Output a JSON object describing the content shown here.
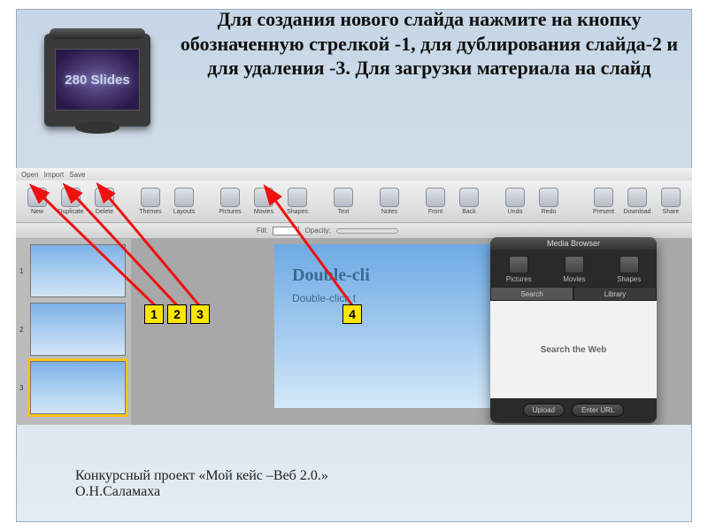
{
  "logo_text": "280 Slides",
  "headline": "Для создания нового слайда нажмите на кнопку обозначенную стрелкой -1, для дублирования слайда-2 и для удаления -3. Для загрузки материала на слайд",
  "browser_tabs": {
    "open": "Open",
    "import": "Import",
    "save": "Save"
  },
  "toolbar": {
    "new": "New",
    "duplicate": "Duplicate",
    "delete": "Delete",
    "themes": "Themes",
    "layouts": "Layouts",
    "pictures": "Pictures",
    "movies": "Movies",
    "shapes": "Shapes",
    "text": "Text",
    "notes": "Notes",
    "front": "Front",
    "back": "Back",
    "undo": "Undo",
    "redo": "Redo",
    "present": "Present",
    "download": "Download",
    "share": "Share"
  },
  "ruler": {
    "fill": "Fill:",
    "opacity": "Opacity:"
  },
  "thumbs": [
    {
      "num": "1"
    },
    {
      "num": "2"
    },
    {
      "num": "3"
    }
  ],
  "slide": {
    "title": "Double-cli",
    "subtitle": "Double-click t"
  },
  "media_browser": {
    "title": "Media Browser",
    "tabs": {
      "pictures": "Pictures",
      "movies": "Movies",
      "shapes": "Shapes"
    },
    "subtabs": {
      "search": "Search",
      "library": "Library"
    },
    "body": "Search the Web",
    "upload": "Upload",
    "enter_url": "Enter URL"
  },
  "markers": {
    "m1": "1",
    "m2": "2",
    "m3": "3",
    "m4": "4"
  },
  "footer_line1": "Конкурсный проект «Мой кейс –Веб 2.0.»",
  "footer_line2": "О.Н.Саламаха"
}
